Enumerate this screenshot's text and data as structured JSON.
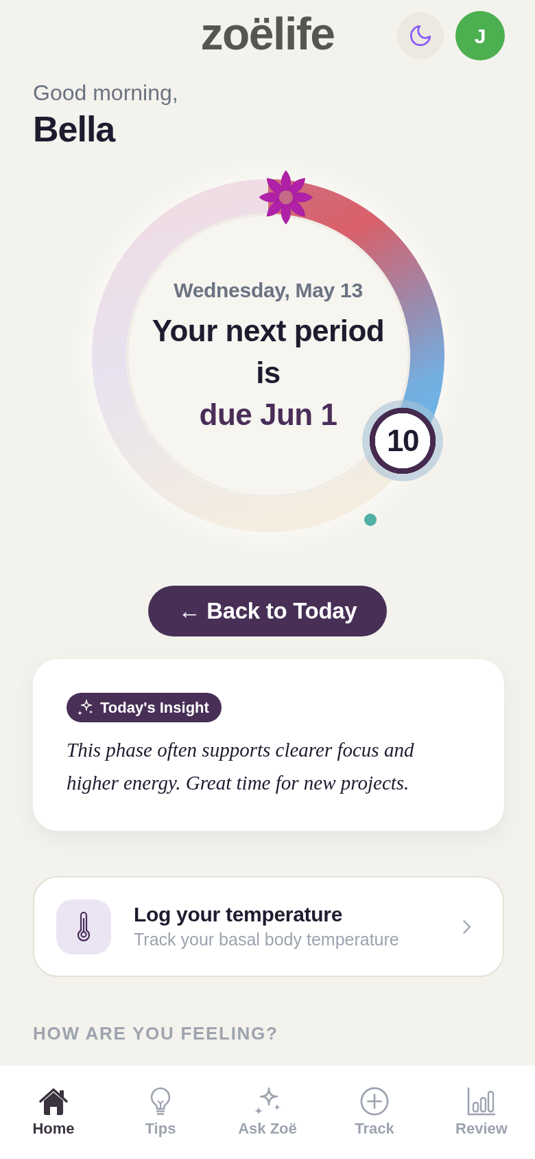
{
  "header": {
    "logo": "zoëlife",
    "avatar_initial": "J"
  },
  "greeting": {
    "salutation": "Good morning,",
    "name": "Bella"
  },
  "cycle": {
    "date": "Wednesday, May 13",
    "headline": "Your next period is",
    "due": "due Jun 1",
    "day": "10",
    "level": 0.34
  },
  "back_button": {
    "label": "← Back to Today"
  },
  "insight": {
    "badge": "Today's Insight",
    "text": "This phase often supports clearer focus and higher energy. Great time for new projects."
  },
  "action_card": {
    "title": "Log your temperature",
    "subtitle": "Track your basal body temperature"
  },
  "section_heading": "HOW ARE YOU FEELING?",
  "nav": [
    {
      "label": "Home",
      "selected": true
    },
    {
      "label": "Tips",
      "selected": false
    },
    {
      "label": "Ask Zoë",
      "selected": false
    },
    {
      "label": "Track",
      "selected": false
    },
    {
      "label": "Review",
      "selected": false
    }
  ]
}
